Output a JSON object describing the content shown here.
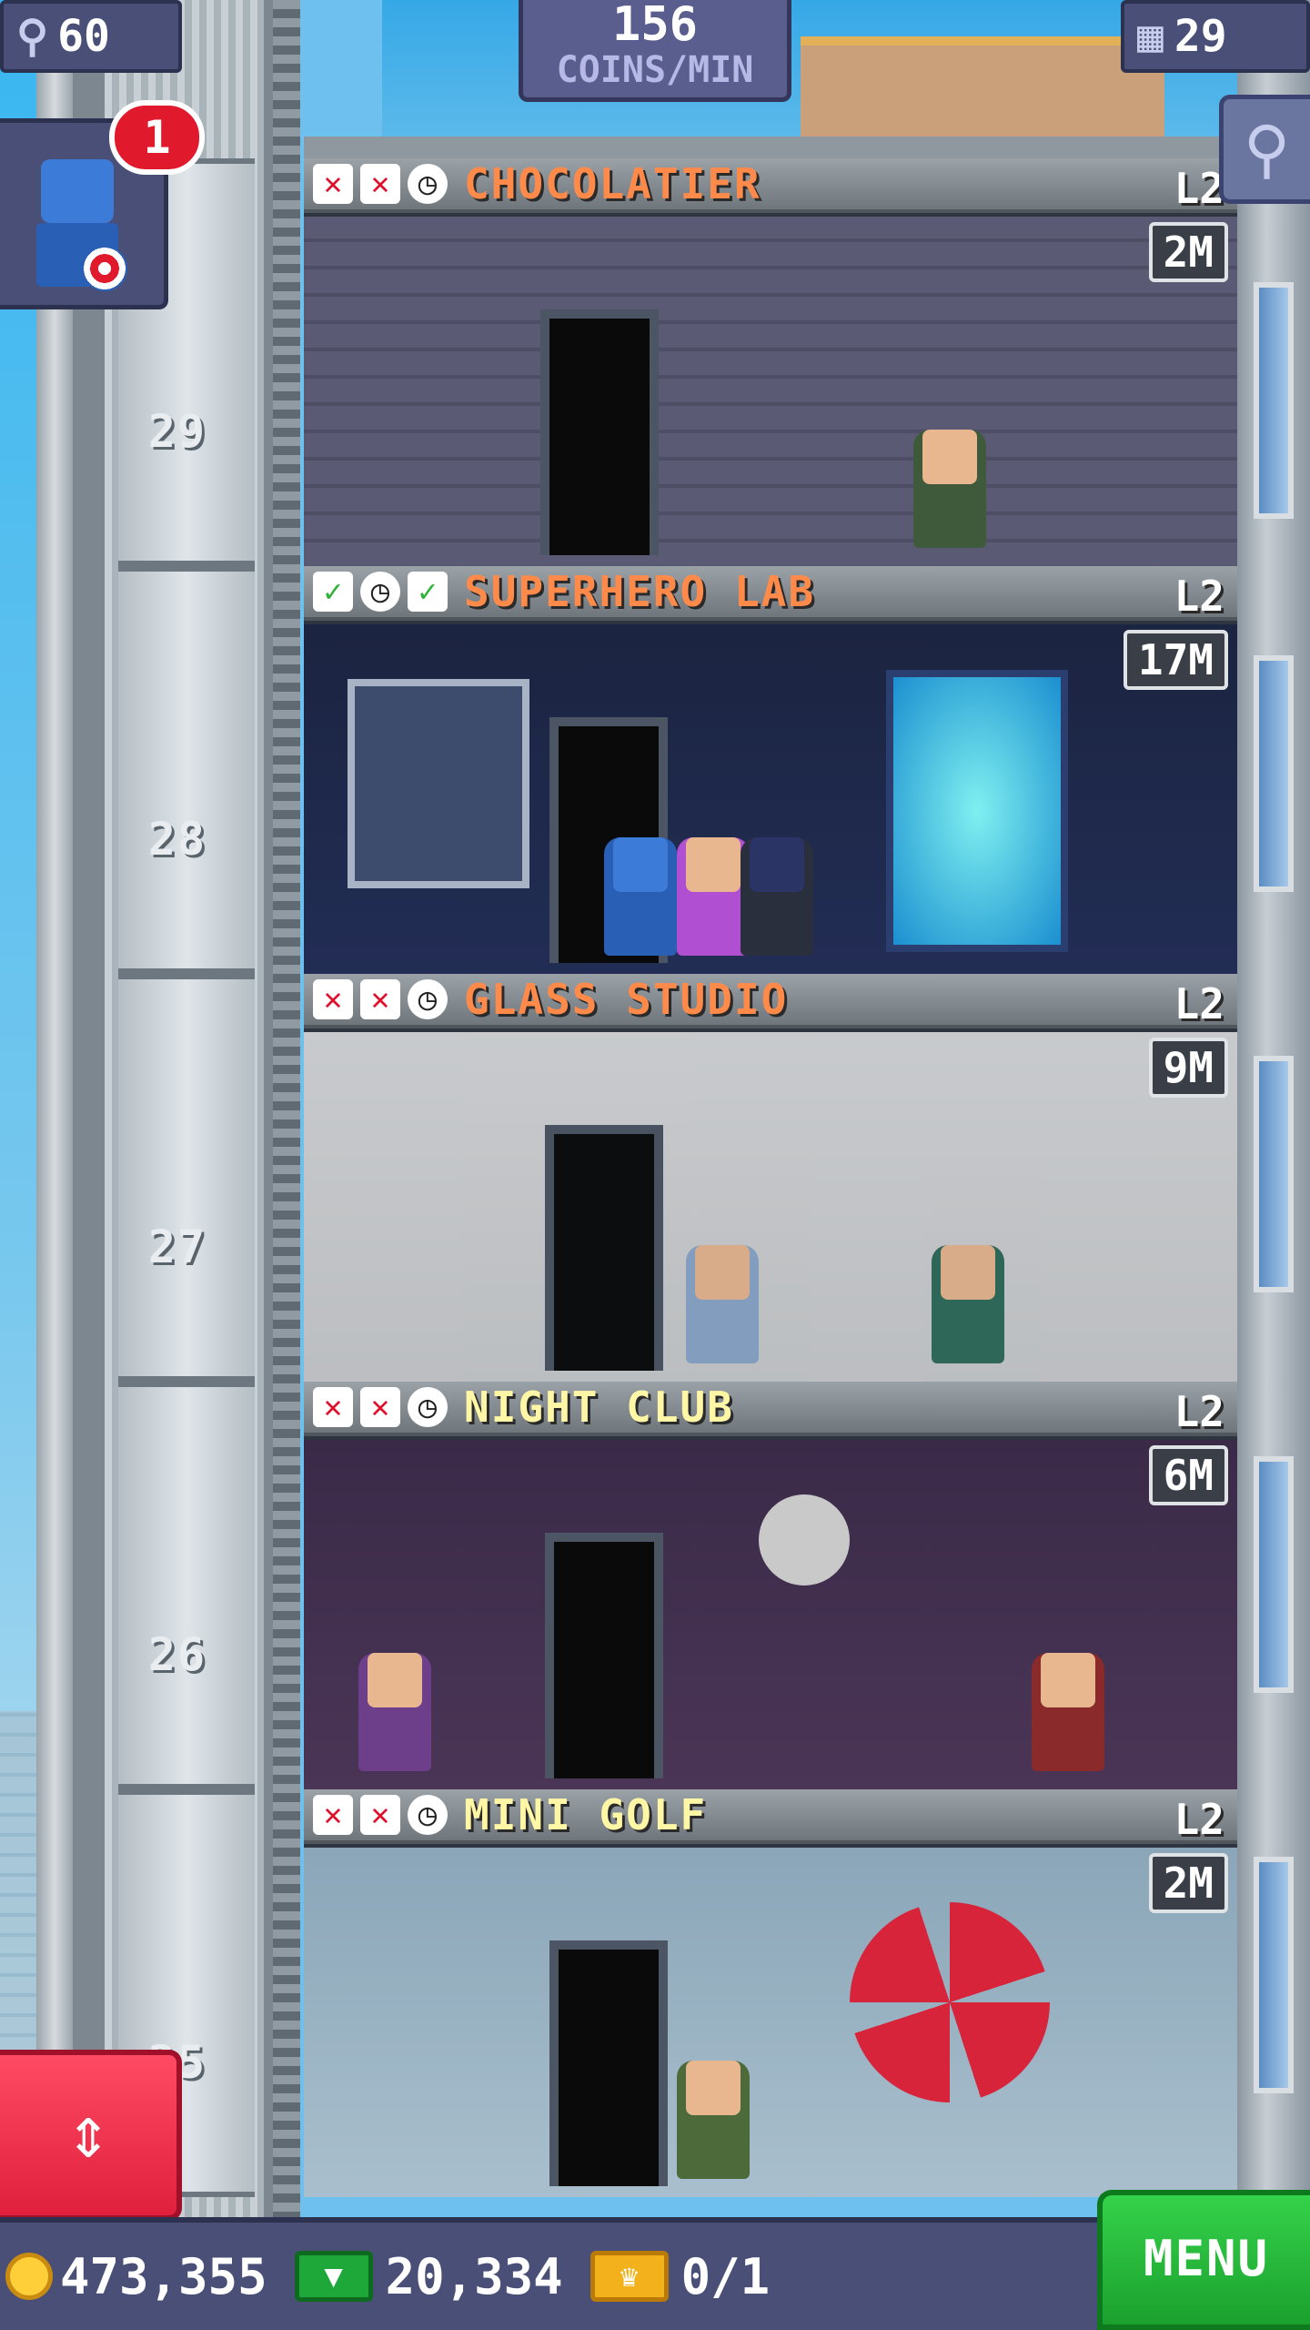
{
  "hud": {
    "population": "60",
    "coins_rate": "156",
    "coins_rate_unit": "COINS/MIN",
    "floors": "29",
    "vip_badge": "1"
  },
  "floors": [
    {
      "num": "29",
      "name": "CHOCOLATIER",
      "level": "L2",
      "stock": "2M",
      "name_color": "#ff8a4a",
      "status": [
        "x",
        "x",
        "clock"
      ]
    },
    {
      "num": "28",
      "name": "SUPERHERO LAB",
      "level": "L2",
      "stock": "17M",
      "name_color": "#ff8a4a",
      "status": [
        "ok",
        "clock",
        "ok"
      ]
    },
    {
      "num": "27",
      "name": "GLASS STUDIO",
      "level": "L2",
      "stock": "9M",
      "name_color": "#ff8a4a",
      "status": [
        "x",
        "x",
        "clock"
      ]
    },
    {
      "num": "26",
      "name": "NIGHT CLUB",
      "level": "L2",
      "stock": "6M",
      "name_color": "#fff7a6",
      "status": [
        "x",
        "x",
        "clock"
      ]
    },
    {
      "num": "25",
      "name": "MINI GOLF",
      "level": "L2",
      "stock": "2M",
      "name_color": "#fff7a6",
      "status": [
        "x",
        "x",
        "clock"
      ]
    }
  ],
  "bottom_bar": {
    "coins": "473,355",
    "bux": "20,334",
    "tickets": "0/1",
    "menu_label": "MENU"
  },
  "icons": {
    "population": "person-icon",
    "floors": "building-icon",
    "zoom": "magnifier-icon",
    "elevator": "up-down-arrows-icon",
    "coin": "coin-icon",
    "bux": "bux-icon",
    "ticket": "vip-ticket-icon"
  },
  "colors": {
    "hud": "#4a4f78",
    "menu": "#1ba02e",
    "elevator_button": "#e0203d",
    "badge": "#e0192c"
  }
}
